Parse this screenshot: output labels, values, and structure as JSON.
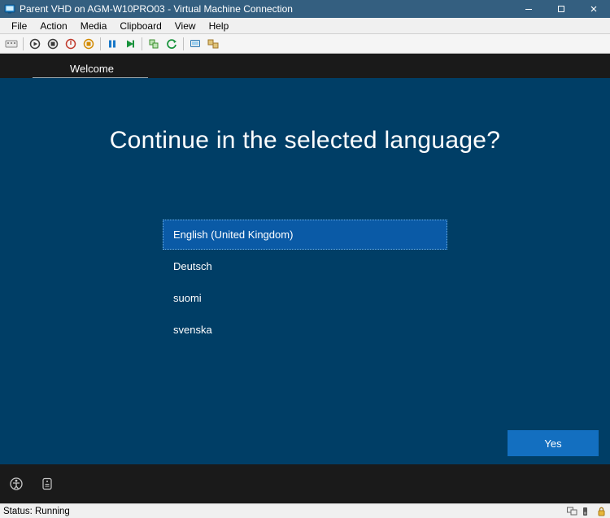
{
  "window": {
    "title": "Parent VHD on AGM-W10PRO03 - Virtual Machine Connection"
  },
  "menu": {
    "file": "File",
    "action": "Action",
    "media": "Media",
    "clipboard": "Clipboard",
    "view": "View",
    "help": "Help"
  },
  "oobe": {
    "tab_label": "Welcome",
    "heading": "Continue in the selected language?",
    "languages": [
      "English (United Kingdom)",
      "Deutsch",
      "suomi",
      "svenska"
    ],
    "yes_label": "Yes"
  },
  "status": {
    "text": "Status: Running"
  }
}
